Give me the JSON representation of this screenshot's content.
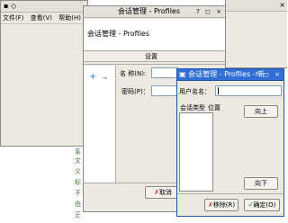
{
  "back_window": {
    "title_icons": "▪ ◇",
    "menu": [
      "文件(F)",
      "查看(V)",
      "帮助(H)"
    ],
    "side_green_chars": [
      "系",
      "文",
      "义",
      "标",
      "不",
      "由",
      "正"
    ]
  },
  "middle_window": {
    "title": "会话管理 - Profiles",
    "title_controls": "? ◻ ×",
    "heading": "会话管理 - Profiles",
    "tab_label": "设置",
    "input_label_1": "名 称(N):",
    "input_label_2": "密码(P)：",
    "add_icon": "+",
    "arrow_icon": "→",
    "cancel_partial": "取消"
  },
  "front_window": {
    "title": "会话管理 - Profiles - 新",
    "title_controls": "? ◻ ×",
    "session_name_label": "用户名名：",
    "session_name_value": "",
    "column_headers": [
      "会话类型",
      "位置"
    ],
    "move_up_button": "向上",
    "move_down_button": "向下",
    "remove_button": "移除(R)",
    "ok_button": "确定(O)",
    "colors": {
      "active_title": "#2f6fd6",
      "field_border": "#7f9db9"
    }
  }
}
